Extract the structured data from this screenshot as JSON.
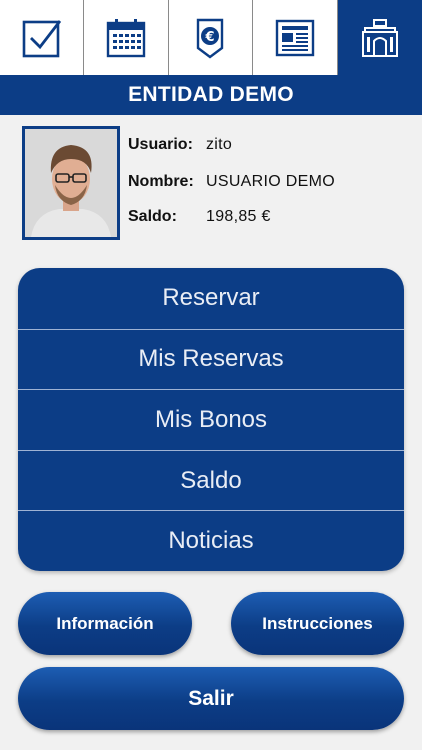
{
  "tabs": [
    {
      "icon": "checkbox-icon"
    },
    {
      "icon": "calendar-icon"
    },
    {
      "icon": "euro-tag-icon"
    },
    {
      "icon": "newspaper-icon"
    },
    {
      "icon": "building-icon",
      "active": true
    }
  ],
  "entity": {
    "name": "ENTIDAD DEMO"
  },
  "profile": {
    "avatar": "user-photo",
    "user_label": "Usuario:",
    "user_value": "zito",
    "name_label": "Nombre:",
    "name_value": "USUARIO DEMO",
    "balance_label": "Saldo:",
    "balance_value": "198,85 €"
  },
  "menu": {
    "items": [
      "Reservar",
      "Mis Reservas",
      "Mis Bonos",
      "Saldo",
      "Noticias"
    ]
  },
  "buttons": {
    "info": "Información",
    "instructions": "Instrucciones",
    "exit": "Salir"
  },
  "colors": {
    "primary": "#0c3d86",
    "background": "#f1f1f1"
  }
}
